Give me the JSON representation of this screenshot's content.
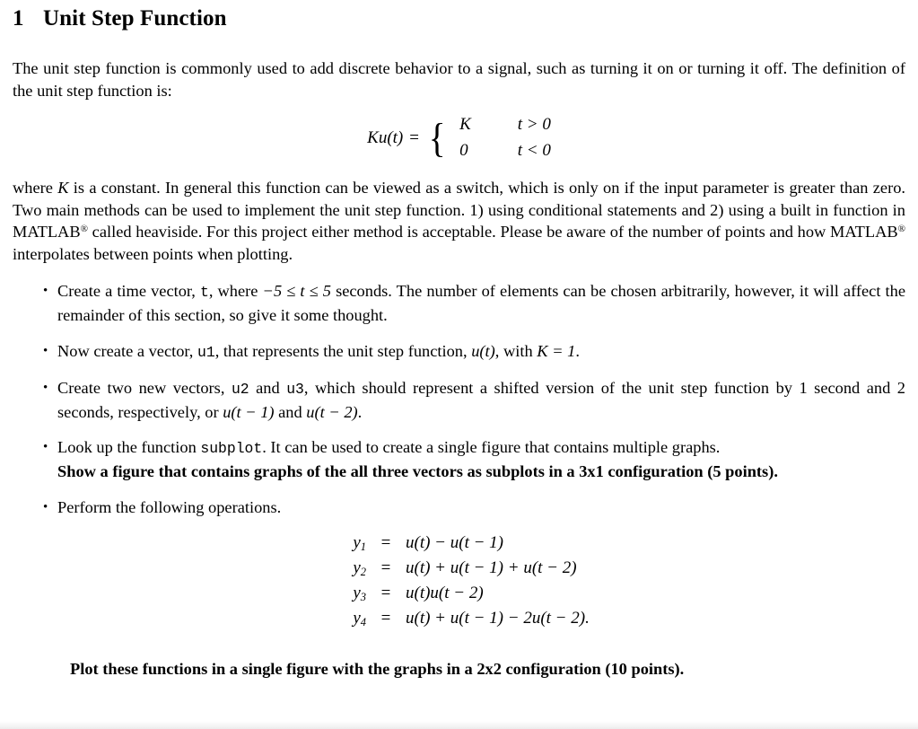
{
  "document": {
    "section": {
      "number": "1",
      "title": "Unit Step Function"
    },
    "intro_paragraph": "The unit step function is commonly used to add discrete behavior to a signal, such as turning it on or turning it off. The definition of the unit step function is:",
    "piecewise_equation": {
      "lhs": "Ku(t)",
      "relation": "=",
      "cases": [
        {
          "value": "K",
          "condition": "t > 0"
        },
        {
          "value": "0",
          "condition": "t < 0"
        }
      ]
    },
    "explanation_paragraph": {
      "part1": "where ",
      "var_k": "K",
      "part2": " is a constant. In general this function can be viewed as a switch, which is only on if the input parameter is greater than zero. Two main methods can be used to implement the unit step function. 1) using conditional statements and 2) using a built in function in MATLAB",
      "reg_mark_1": "®",
      "part3": " called heaviside. For this project either method is acceptable. Please be aware of the number of points and how MATLAB",
      "reg_mark_2": "®",
      "part4": " interpolates between points when plotting."
    },
    "bullets": {
      "b1": {
        "t1": "Create a time vector, ",
        "code_t": "t",
        "t2": ", where ",
        "range": "−5 ≤ t ≤ 5",
        "t3": " seconds.  The number of elements can be chosen arbitrarily, however, it will affect the remainder of this section, so give it some thought."
      },
      "b2": {
        "t1": "Now create a vector, ",
        "code_u1": "u1",
        "t2": ", that represents the unit step function, ",
        "math_ut": "u(t)",
        "t3": ", with ",
        "math_k1": "K = 1",
        "t4": "."
      },
      "b3": {
        "t1": "Create two new vectors, ",
        "code_u2": "u2",
        "t2": " and ",
        "code_u3": "u3",
        "t3": ", which should represent a shifted version of the unit step function by 1 second and 2 seconds, respectively, or ",
        "math_ut1": "u(t − 1)",
        "t4": " and ",
        "math_ut2": "u(t − 2)",
        "t5": "."
      },
      "b4": {
        "t1": "Look up the function ",
        "code_subplot": "subplot",
        "t2": ". It can be used to create a single figure that contains multiple graphs.",
        "bold": "Show a figure that contains graphs of the all three vectors as subplots in a 3x1 configuration (5 points)."
      },
      "b5": {
        "t1": "Perform the following operations."
      }
    },
    "equation_array": [
      {
        "lhs": "y",
        "lhs_sub": "1",
        "relation": "=",
        "rhs": "u(t) − u(t − 1)"
      },
      {
        "lhs": "y",
        "lhs_sub": "2",
        "relation": "=",
        "rhs": "u(t) + u(t − 1) + u(t − 2)"
      },
      {
        "lhs": "y",
        "lhs_sub": "3",
        "relation": "=",
        "rhs": "u(t)u(t − 2)"
      },
      {
        "lhs": "y",
        "lhs_sub": "4",
        "relation": "=",
        "rhs": "u(t) + u(t − 1) − 2u(t − 2)."
      }
    ],
    "final_note": "Plot these functions in a single figure with the graphs in a 2x2 configuration (10 points)."
  }
}
